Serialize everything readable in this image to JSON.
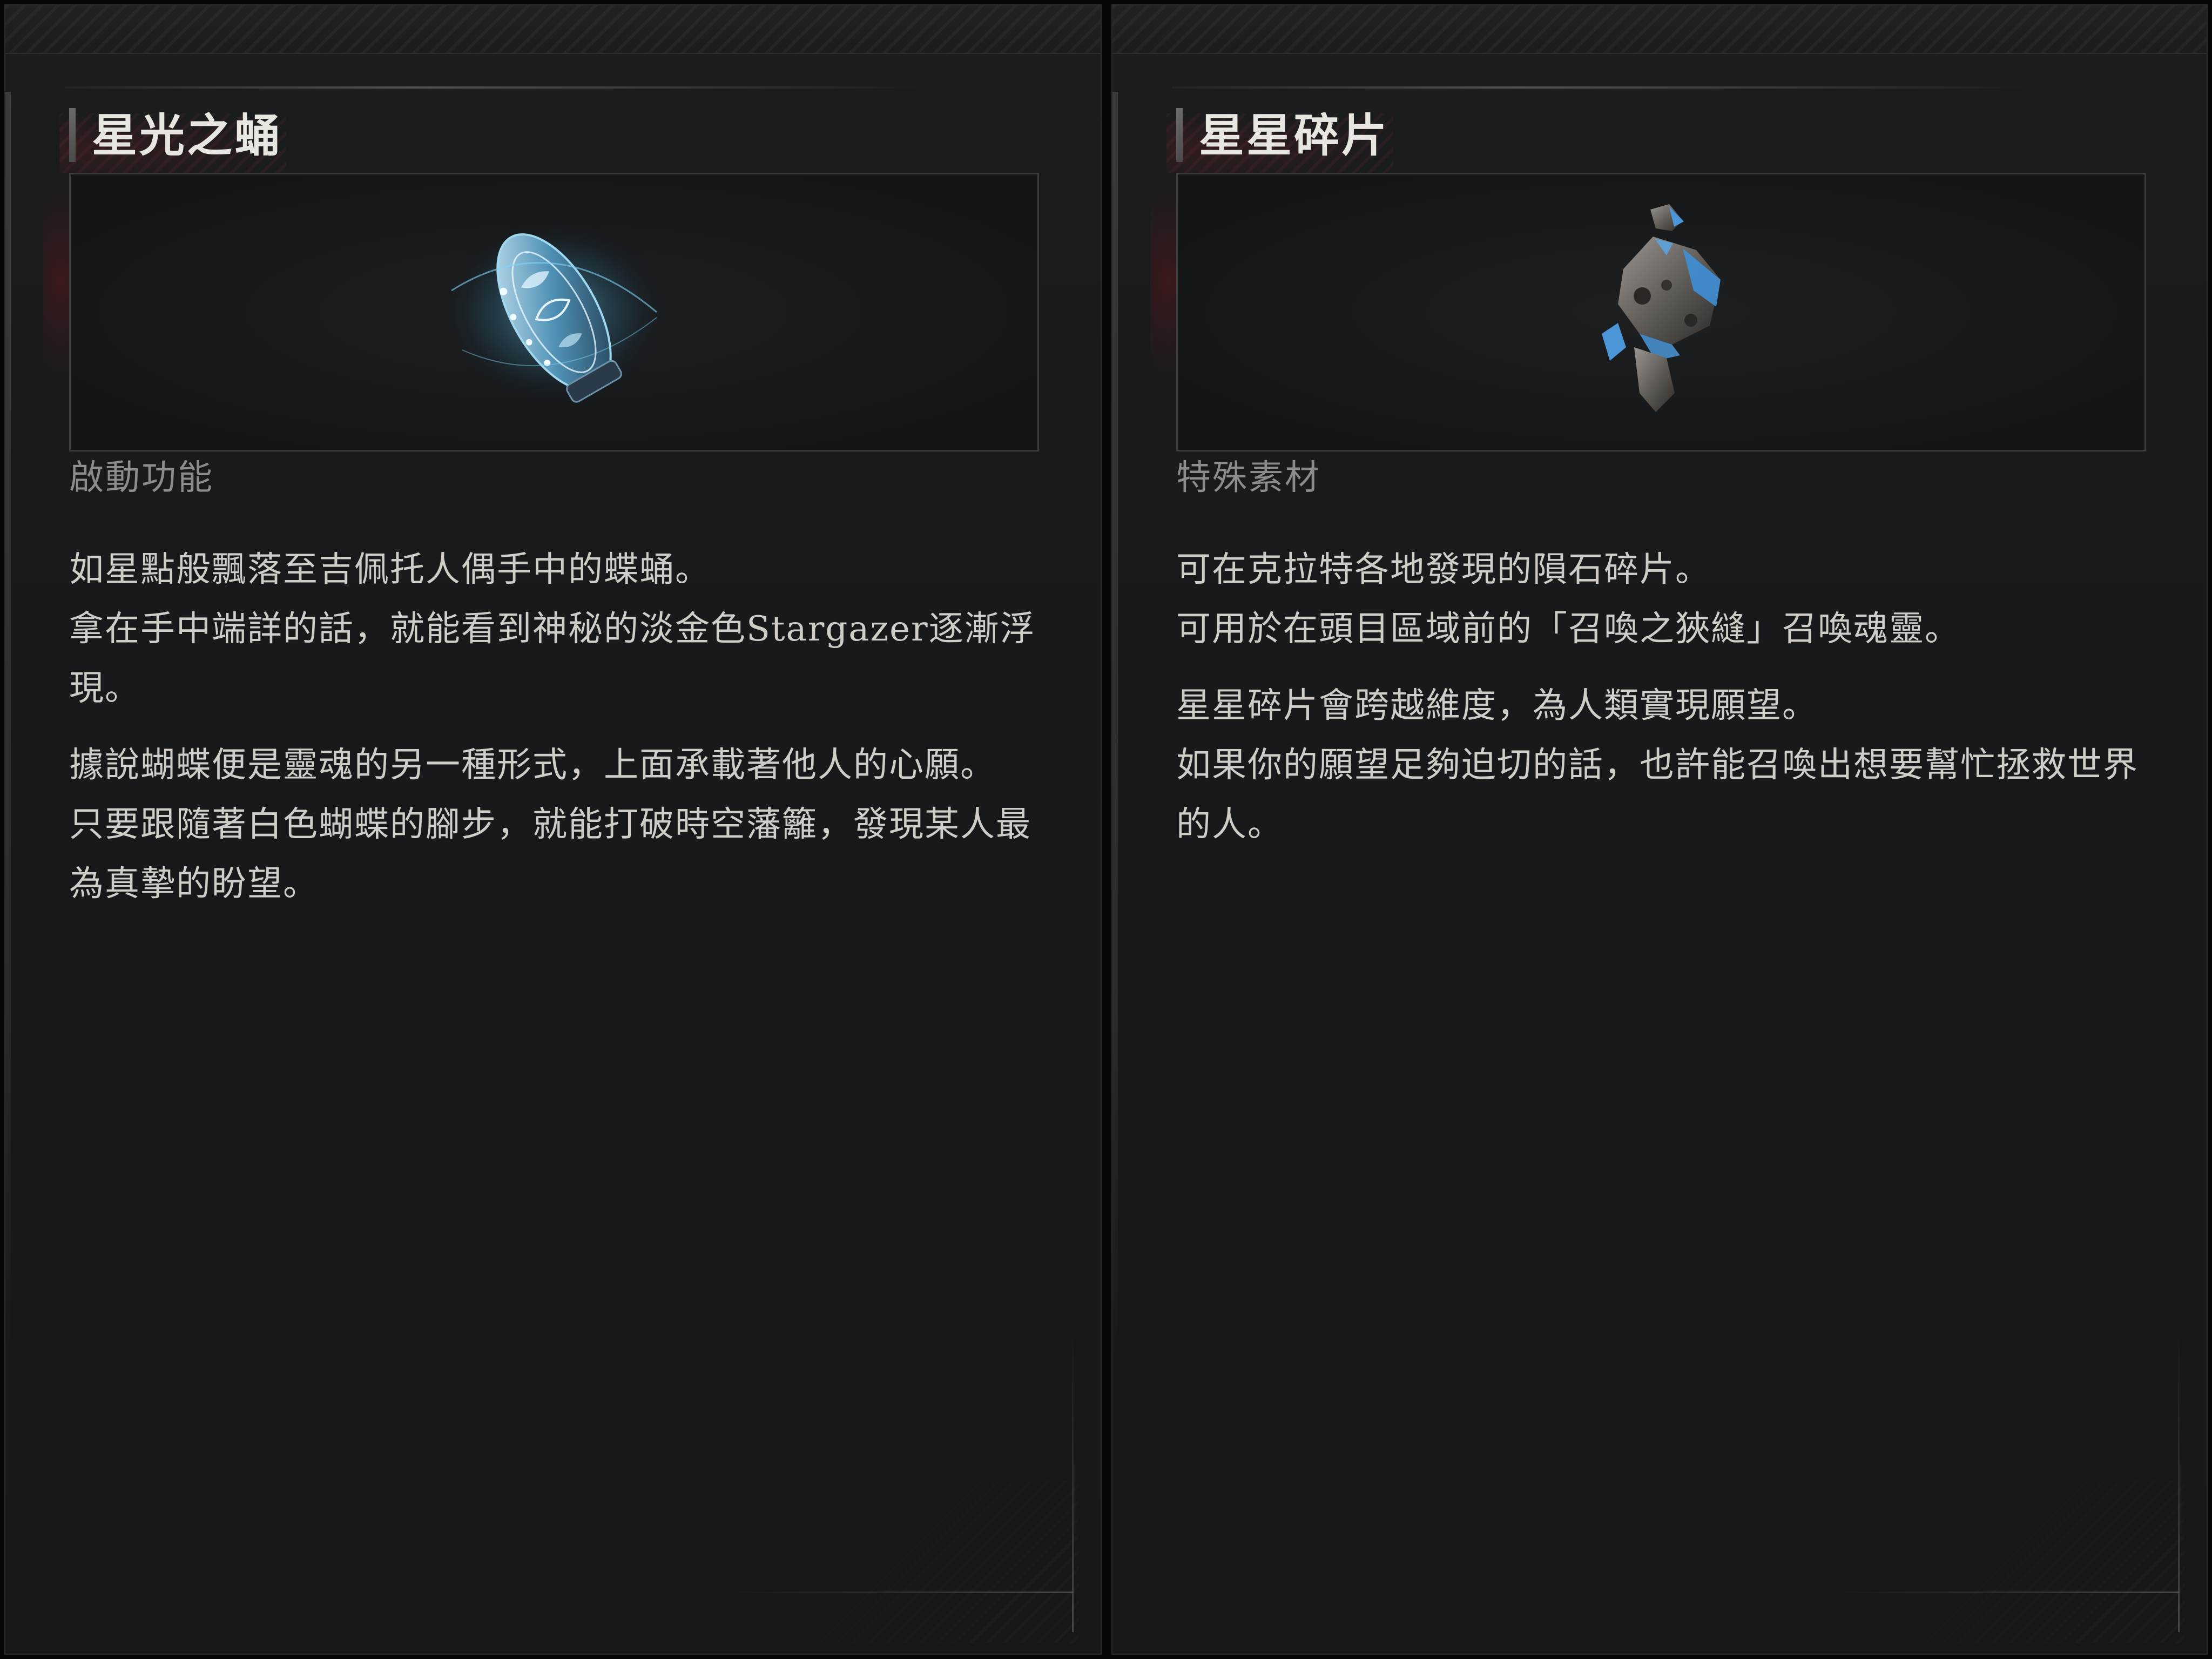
{
  "left_panel": {
    "title": "星光之蛹",
    "category": "啟動功能",
    "item_icon": "starlight-chrysalis-icon",
    "paragraphs": [
      "如星點般飄落至吉佩托人偶手中的蝶蛹。\n拿在手中端詳的話，就能看到神秘的淡金色Stargazer逐漸浮現。",
      "據說蝴蝶便是靈魂的另一種形式，上面承載著他人的心願。\n只要跟隨著白色蝴蝶的腳步，就能打破時空藩籬，發現某人最為真摯的盼望。"
    ]
  },
  "right_panel": {
    "title": "星星碎片",
    "category": "特殊素材",
    "item_icon": "star-fragment-icon",
    "paragraphs": [
      "可在克拉特各地發現的隕石碎片。\n可用於在頭目區域前的「召喚之狹縫」召喚魂靈。",
      "星星碎片會跨越維度，為人類實現願望。\n如果你的願望足夠迫切的話，也許能召喚出想要幫忙拯救世界的人。"
    ]
  },
  "colors": {
    "background": "#050505",
    "panel": "#1a1b1d",
    "title_text": "#e8e6e1",
    "category_text": "#8c8c8a",
    "body_text": "#cfcdc7",
    "chrysalis_glow": "#5ab8e0",
    "fragment_blue": "#3f8fd6"
  }
}
